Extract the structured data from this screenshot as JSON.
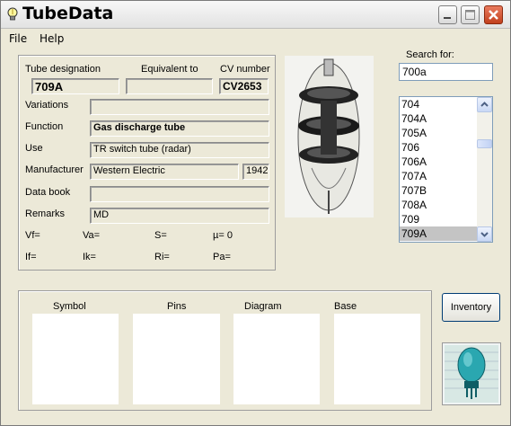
{
  "window": {
    "title": "TubeData"
  },
  "menu": [
    {
      "label": "File"
    },
    {
      "label": "Help"
    }
  ],
  "details": {
    "tube_designation_label": "Tube designation",
    "tube_designation": "709A",
    "equivalent_label": "Equivalent to",
    "equivalent": "",
    "cv_label": "CV number",
    "cv": "CV2653",
    "variations_label": "Variations",
    "variations": "",
    "function_label": "Function",
    "function": "Gas discharge tube",
    "use_label": "Use",
    "use": "TR switch tube (radar)",
    "manufacturer_label": "Manufacturer",
    "manufacturer": "Western Electric",
    "year": "1942",
    "databook_label": "Data book",
    "databook": "",
    "remarks_label": "Remarks",
    "remarks": "MD",
    "vf": "Vf=",
    "va": "Va=",
    "s": "S=",
    "mu": "µ=   0",
    "if": "If=",
    "ik": "Ik=",
    "ri": "Ri=",
    "pa": "Pa="
  },
  "search": {
    "label": "Search for:",
    "value": "700a"
  },
  "tube_list": {
    "items": [
      "704",
      "704A",
      "705A",
      "706",
      "706A",
      "707A",
      "707B",
      "708A",
      "709",
      "709A"
    ],
    "selected": "709A"
  },
  "images": {
    "symbol": "Symbol",
    "pins": "Pins",
    "diagram": "Diagram",
    "base": "Base"
  },
  "inventory_button": "Inventory",
  "colors": {
    "selected_row": "#c4c4c4",
    "window_bg": "#ECE9D8",
    "close_button": "#c2401e"
  }
}
